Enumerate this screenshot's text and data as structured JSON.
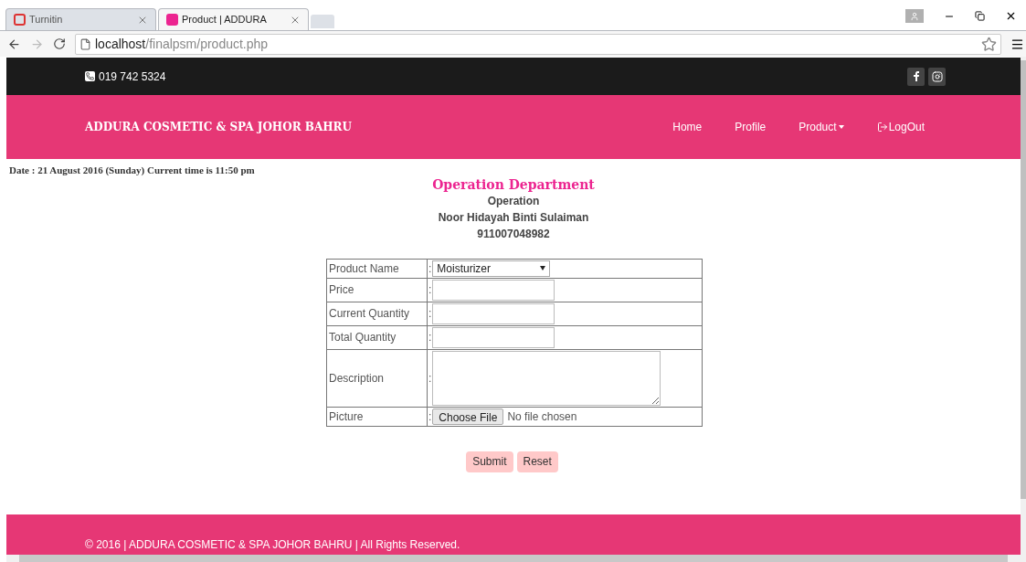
{
  "browser": {
    "tabs": [
      {
        "title": "Turnitin",
        "selected": false
      },
      {
        "title": "Product | ADDURA",
        "selected": true
      }
    ],
    "url_host": "localhost",
    "url_path": "/finalpsm/product.php"
  },
  "topbar": {
    "phone": "019 742 5324"
  },
  "navbar": {
    "brand": "ADDURA COSMETIC & SPA JOHOR BAHRU",
    "items": [
      {
        "label": "Home",
        "kind": "link"
      },
      {
        "label": "Profile",
        "kind": "link"
      },
      {
        "label": "Product",
        "kind": "dropdown"
      },
      {
        "label": "LogOut",
        "kind": "logout"
      }
    ]
  },
  "date_line": "Date : 21 August 2016 (Sunday) Current time is 11:50 pm",
  "header": {
    "department": "Operation Department",
    "role": "Operation",
    "name": "Noor Hidayah Binti Sulaiman",
    "id": "911007048982"
  },
  "form": {
    "rows": [
      {
        "label": "Product Name",
        "separator": ":",
        "kind": "select",
        "value": "Moisturizer"
      },
      {
        "label": "Price",
        "separator": ":",
        "kind": "text"
      },
      {
        "label": "Current Quantity",
        "separator": ":",
        "kind": "text"
      },
      {
        "label": "Total Quantity",
        "separator": ":",
        "kind": "text"
      },
      {
        "label": "Description",
        "separator": ":",
        "kind": "textarea"
      },
      {
        "label": "Picture",
        "separator": ":",
        "kind": "file",
        "button": "Choose File",
        "status": "No file chosen"
      }
    ],
    "buttons": [
      "Submit",
      "Reset"
    ]
  },
  "footer": "© 2016 | ADDURA COSMETIC & SPA JOHOR BAHRU | All Rights Reserved."
}
